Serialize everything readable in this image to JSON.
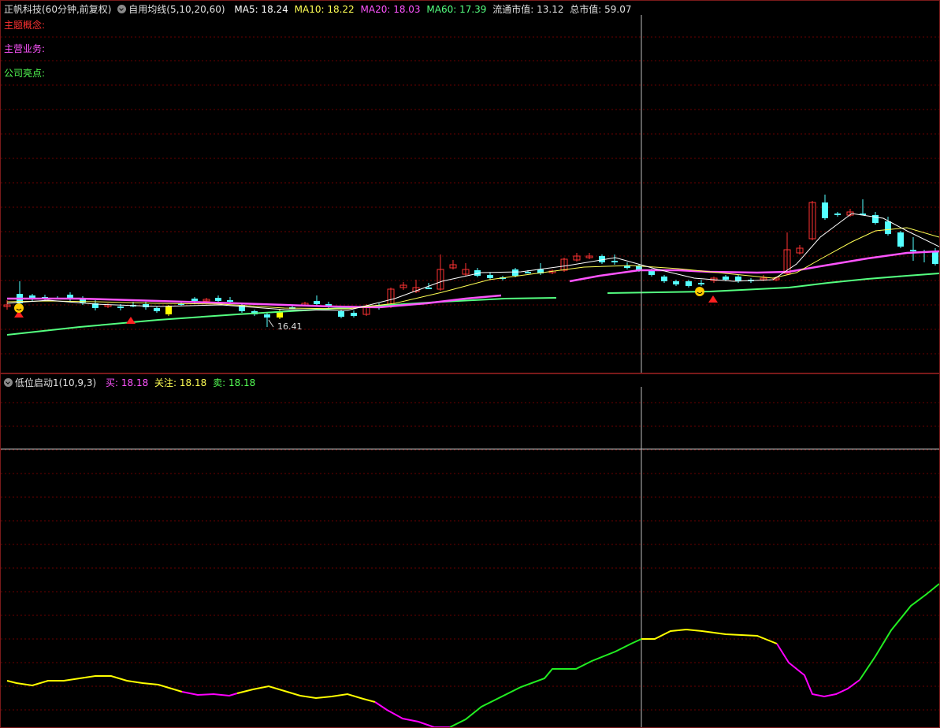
{
  "main": {
    "stock_title": "正帆科技(60分钟,前复权)",
    "indicator_name": "自用均线(5,10,20,60)",
    "ma5": "MA5: 18.24",
    "ma10": "MA10: 18.22",
    "ma20": "MA20: 18.03",
    "ma60": "MA60: 17.39",
    "float_cap": "流通市值: 13.12",
    "total_cap": "总市值: 59.07",
    "theme_label": "主题概念:",
    "business_label": "主营业务:",
    "highlight_label": "公司亮点:",
    "low_price_label": "16.41"
  },
  "sub": {
    "indicator_name": "低位启动1(10,9,3)",
    "buy": "买: 18.18",
    "watch": "关注: 18.18",
    "sell": "卖: 18.18"
  },
  "colors": {
    "up": "#ff3232",
    "down": "#54ffff",
    "ma5": "#ffffff",
    "ma10": "#ffff54",
    "ma20": "#ff54ff",
    "ma60": "#54ff80",
    "grid": "#6a0000",
    "crosshair": "#bbbbbb"
  }
}
